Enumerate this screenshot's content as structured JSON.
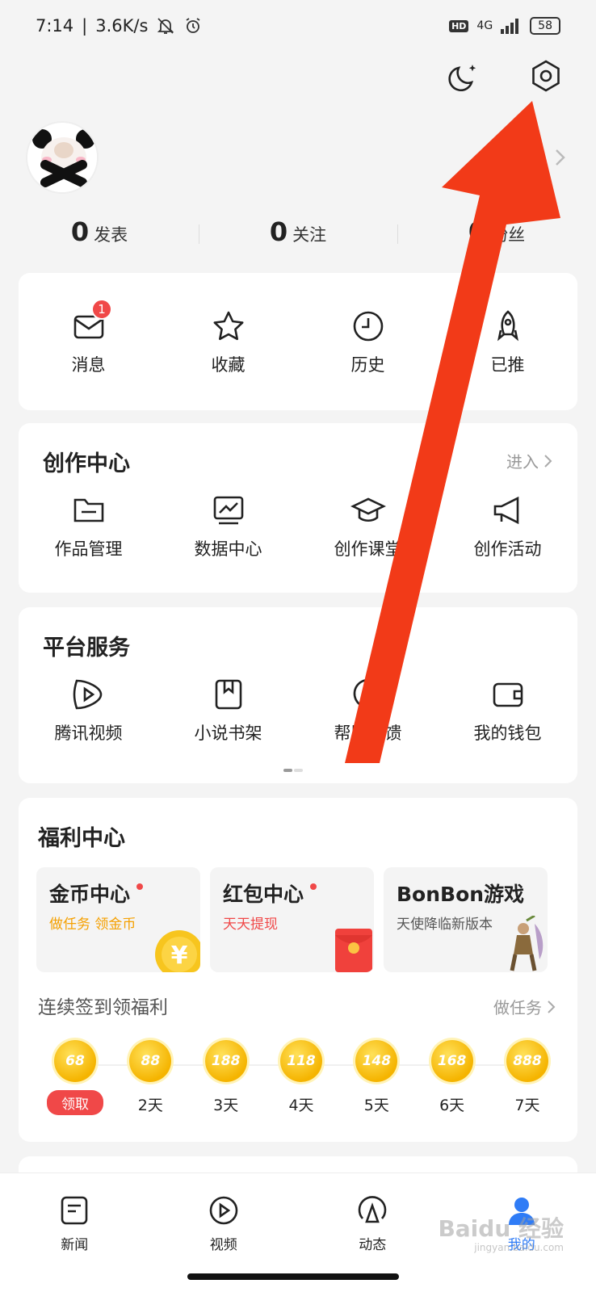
{
  "status_bar": {
    "time": "7:14",
    "speed": "3.6K/s",
    "hd": "HD",
    "network": "4G",
    "battery": "58"
  },
  "profile": {
    "stats": [
      {
        "num": "0",
        "label": "发表"
      },
      {
        "num": "0",
        "label": "关注"
      },
      {
        "num": "0",
        "label": "粉丝"
      }
    ]
  },
  "quick": {
    "items": [
      {
        "label": "消息",
        "icon": "mail-icon",
        "badge": "1"
      },
      {
        "label": "收藏",
        "icon": "star-icon"
      },
      {
        "label": "历史",
        "icon": "clock-icon"
      },
      {
        "label": "已推",
        "icon": "rocket-icon"
      }
    ]
  },
  "creation": {
    "title": "创作中心",
    "enter": "进入",
    "items": [
      {
        "label": "作品管理",
        "icon": "folder-icon"
      },
      {
        "label": "数据中心",
        "icon": "chart-icon"
      },
      {
        "label": "创作课堂",
        "icon": "graduation-cap-icon"
      },
      {
        "label": "创作活动",
        "icon": "megaphone-icon"
      }
    ]
  },
  "services": {
    "title": "平台服务",
    "items": [
      {
        "label": "腾讯视频",
        "icon": "tencent-video-icon"
      },
      {
        "label": "小说书架",
        "icon": "bookmark-icon"
      },
      {
        "label": "帮助反馈",
        "icon": "help-icon"
      },
      {
        "label": "我的钱包",
        "icon": "wallet-icon"
      }
    ]
  },
  "welfare": {
    "title": "福利中心",
    "tiles": [
      {
        "title": "金币中心",
        "sub": "做任务 领金币",
        "sub_color": "#f5a000"
      },
      {
        "title": "红包中心",
        "sub": "天天提现",
        "sub_color": "#f04848"
      },
      {
        "title": "BonBon游戏",
        "sub": "天使降临新版本",
        "sub_color": "#555555"
      }
    ],
    "checkin_title": "连续签到领福利",
    "task_link": "做任务",
    "claim": "领取",
    "coins": [
      {
        "value": "68",
        "day": ""
      },
      {
        "value": "88",
        "day": "2天"
      },
      {
        "value": "188",
        "day": "3天"
      },
      {
        "value": "118",
        "day": "4天"
      },
      {
        "value": "148",
        "day": "5天"
      },
      {
        "value": "168",
        "day": "6天"
      },
      {
        "value": "888",
        "day": "7天"
      }
    ]
  },
  "tabbar": {
    "tabs": [
      {
        "label": "新闻",
        "icon": "news-icon"
      },
      {
        "label": "视频",
        "icon": "play-icon"
      },
      {
        "label": "动态",
        "icon": "broadcast-icon"
      },
      {
        "label": "我的",
        "icon": "user-icon",
        "active": true
      }
    ]
  },
  "colors": {
    "accent": "#2f7cf6",
    "red": "#f04848",
    "arrow": "#f23a18",
    "gold": "#f5b400"
  },
  "watermark": {
    "main": "Baidu 经验",
    "sub": "jingyan.baidu.com"
  }
}
